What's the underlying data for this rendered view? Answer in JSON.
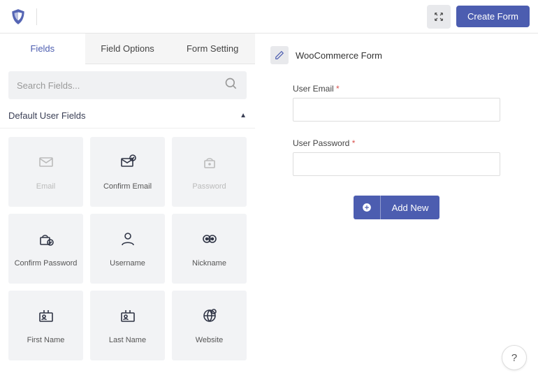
{
  "header": {
    "create_label": "Create Form"
  },
  "tabs": {
    "fields": "Fields",
    "field_options": "Field Options",
    "form_setting": "Form Setting"
  },
  "search": {
    "placeholder": "Search Fields..."
  },
  "section": {
    "default_user_fields": "Default User Fields"
  },
  "tiles": [
    {
      "label": "Email",
      "icon": "envelope",
      "disabled": true
    },
    {
      "label": "Confirm Email",
      "icon": "envelope-check",
      "disabled": false
    },
    {
      "label": "Password",
      "icon": "lock",
      "disabled": true
    },
    {
      "label": "Confirm Password",
      "icon": "lock-check",
      "disabled": false
    },
    {
      "label": "Username",
      "icon": "user",
      "disabled": false
    },
    {
      "label": "Nickname",
      "icon": "eyes",
      "disabled": false
    },
    {
      "label": "First Name",
      "icon": "id-card",
      "disabled": false
    },
    {
      "label": "Last Name",
      "icon": "id-card",
      "disabled": false
    },
    {
      "label": "Website",
      "icon": "globe",
      "disabled": false
    }
  ],
  "form": {
    "title": "WooCommerce Form",
    "fields": [
      {
        "label": "User Email"
      },
      {
        "label": "User Password"
      }
    ],
    "add_new_label": "Add New"
  },
  "help": {
    "label": "?"
  }
}
